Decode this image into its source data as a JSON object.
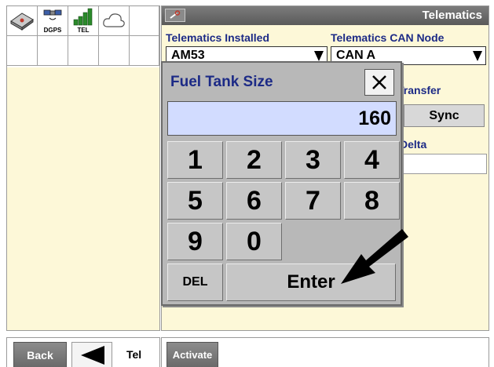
{
  "left_panel": {
    "shortcuts": [
      {
        "icon": "book-icon",
        "caption": ""
      },
      {
        "icon": "satellite-icon",
        "caption": "DGPS"
      },
      {
        "icon": "signal-bars-icon",
        "caption": "TEL"
      },
      {
        "icon": "cloud-icon",
        "caption": ""
      },
      {
        "icon": "",
        "caption": ""
      }
    ]
  },
  "right_panel": {
    "title": "Telematics",
    "installed_label": "Telematics Installed",
    "installed_value": "AM53",
    "can_node_label": "Telematics CAN Node",
    "can_node_value": "CAN A",
    "transfer_label": "Transfer",
    "sync_label": "Sync",
    "delta_label": "Delta"
  },
  "dialog": {
    "title": "Fuel Tank Size",
    "value": "160",
    "keys": [
      "1",
      "2",
      "3",
      "4",
      "5",
      "6",
      "7",
      "8",
      "9",
      "0"
    ],
    "del_label": "DEL",
    "enter_label": "Enter"
  },
  "bottom_bar": {
    "back_label": "Back",
    "tel_label": "Tel",
    "activate_label": "Activate"
  },
  "colors": {
    "panel_bg": "#fdf8d8",
    "label_blue": "#1c2a86",
    "display_bg": "#d2dcff",
    "title_bar": "#6a6a6a"
  }
}
